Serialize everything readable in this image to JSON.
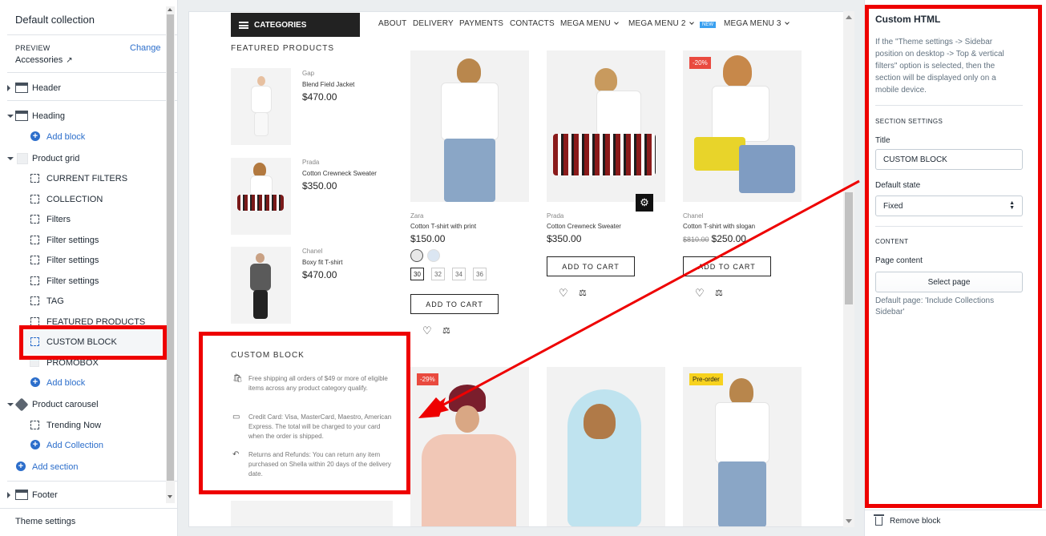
{
  "sidebar": {
    "collection_title": "Default collection",
    "preview_label": "PREVIEW",
    "preview_value": "Accessories",
    "change_label": "Change",
    "sections": [
      {
        "label": "Header"
      },
      {
        "label": "Heading"
      },
      {
        "label": "Product grid"
      },
      {
        "label": "Product carousel"
      },
      {
        "label": "Footer"
      }
    ],
    "heading_add_block": "Add block",
    "product_grid_blocks": [
      "CURRENT FILTERS",
      "COLLECTION",
      "Filters",
      "Filter settings",
      "Filter settings",
      "Filter settings",
      "TAG",
      "FEATURED PRODUCTS",
      "CUSTOM BLOCK",
      "PROMOBOX"
    ],
    "product_grid_add_block": "Add block",
    "carousel_blocks": [
      "Trending Now"
    ],
    "carousel_add": "Add Collection",
    "add_section": "Add section",
    "theme_settings": "Theme settings"
  },
  "preview": {
    "nav": {
      "categories": "CATEGORIES",
      "items": [
        "ABOUT",
        "DELIVERY",
        "PAYMENTS",
        "CONTACTS",
        "MEGA MENU",
        "MEGA MENU 2",
        "MEGA MENU 3"
      ],
      "new_badge": "NEW"
    },
    "featured_title": "FEATURED PRODUCTS",
    "featured": [
      {
        "brand": "Gap",
        "name": "Blend Field Jacket",
        "price": "$470.00"
      },
      {
        "brand": "Prada",
        "name": "Cotton Crewneck Sweater",
        "price": "$350.00"
      },
      {
        "brand": "Chanel",
        "name": "Boxy fit T-shirt",
        "price": "$470.00"
      }
    ],
    "products": [
      {
        "brand": "Zara",
        "name": "Cotton T-shirt with print",
        "price": "$150.00",
        "sizes": [
          "30",
          "32",
          "34",
          "36"
        ],
        "button": "ADD TO CART"
      },
      {
        "brand": "Prada",
        "name": "Cotton Crewneck Sweater",
        "price": "$350.00",
        "button": "ADD TO CART"
      },
      {
        "brand": "Chanel",
        "name": "Cotton T-shirt with slogan",
        "old_price": "$810.00",
        "price": "$250.00",
        "badge": "-20%",
        "button": "ADD TO CART"
      }
    ],
    "row2_badges": {
      "first": "-29%",
      "third": "Pre-order"
    },
    "custom_block": {
      "title": "CUSTOM BLOCK",
      "items": [
        {
          "icon": "shopping-bag-icon",
          "text": "Free shipping all orders of $49 or more of eligible items across any product category qualify."
        },
        {
          "icon": "credit-card-icon",
          "text": "Credit Card: Visa, MasterCard, Maestro, American Express. The total will be charged to your card when the order is shipped."
        },
        {
          "icon": "return-arrow-icon",
          "text": "Returns and Refunds: You can return any item purchased on Shella within 20 days of the delivery date."
        }
      ]
    }
  },
  "panel": {
    "title": "Custom HTML",
    "description": "If the \"Theme settings -> Sidebar position on desktop -> Top & vertical filters\" option is selected, then the section will be displayed only on a mobile device.",
    "section_settings": "SECTION SETTINGS",
    "title_label": "Title",
    "title_value": "CUSTOM BLOCK",
    "default_state_label": "Default state",
    "default_state_value": "Fixed",
    "content_heading": "CONTENT",
    "page_content_label": "Page content",
    "select_page": "Select page",
    "default_page_hint": "Default page: 'Include Collections Sidebar'",
    "remove_block": "Remove block"
  },
  "colors": {
    "accent": "#2c6ecb",
    "annotation": "#ee0000",
    "sale_badge": "#e94a3f",
    "preorder_badge": "#f7d21e"
  }
}
